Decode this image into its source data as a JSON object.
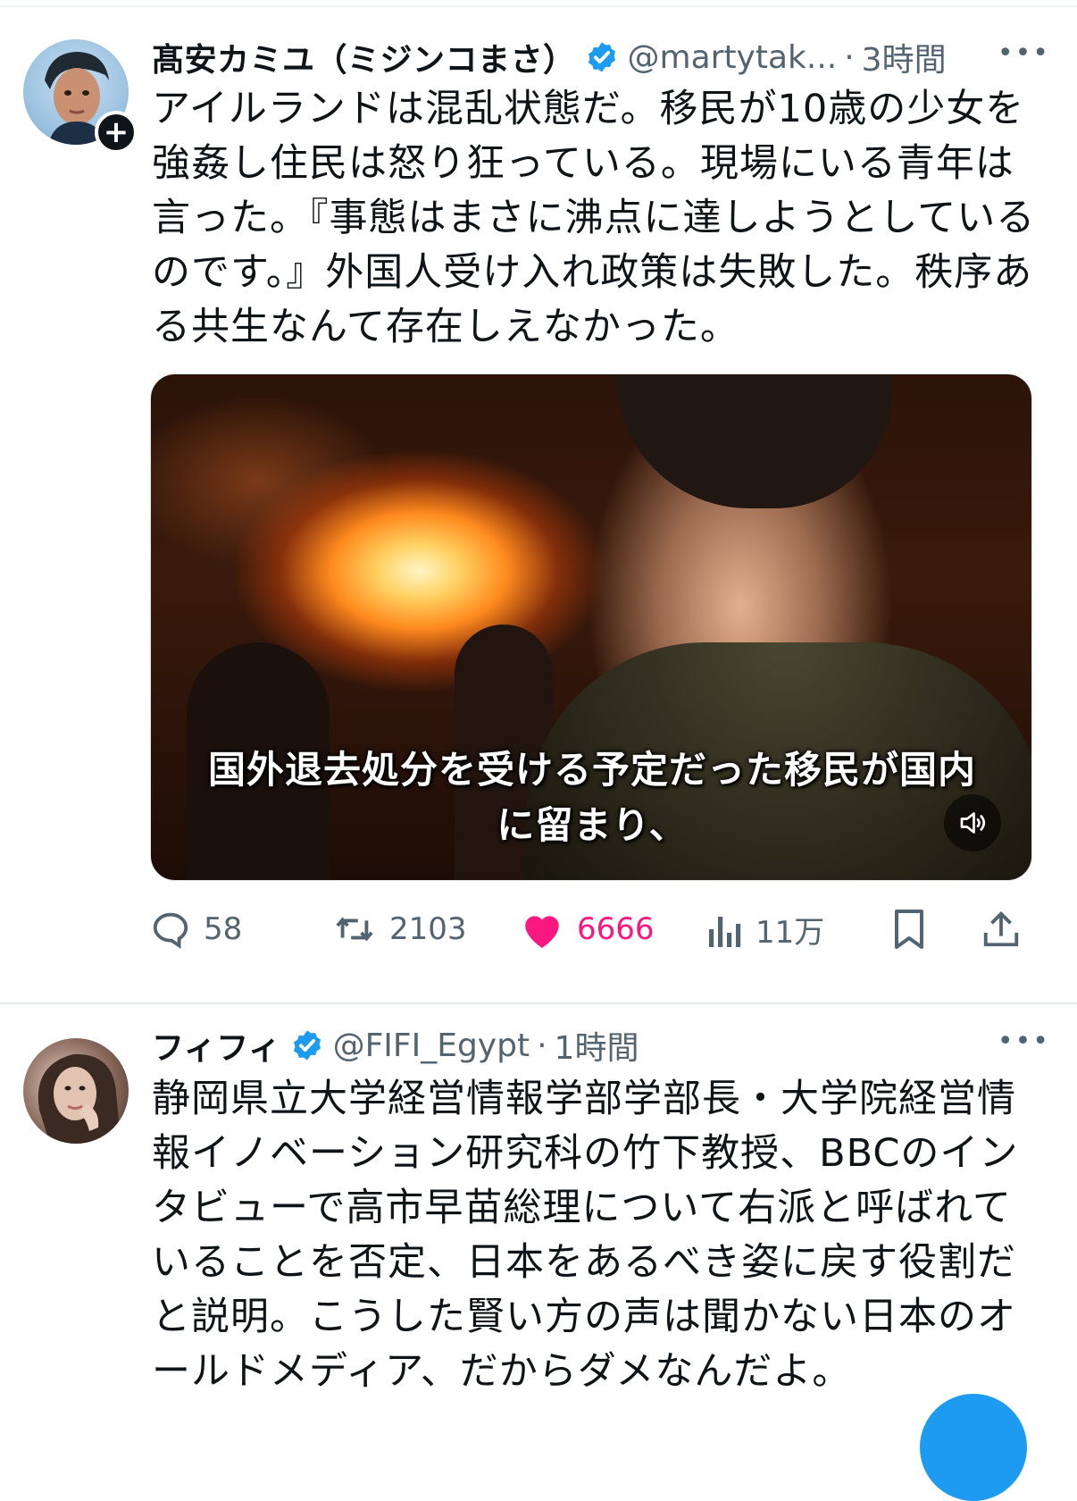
{
  "tweets": [
    {
      "display_name": "髙安カミユ（ミジンコまさ）",
      "handle": "@martytak...",
      "separator": "·",
      "time": "3時間",
      "text": "アイルランドは混乱状態だ。移民が10歳の少女を強姦し住民は怒り狂っている。現場にいる青年は言った。『事態はまさに沸点に達しようとしているのです。』外国人受け入れ政策は失敗した。秩序ある共生なんて存在しえなかった。",
      "media": {
        "caption": "国外退去処分を受ける予定だった移民が国内に留まり、",
        "sound_icon": "speaker-icon"
      },
      "actions": {
        "replies": "58",
        "retweets": "2103",
        "likes": "6666",
        "views": "11万"
      }
    },
    {
      "display_name": "フィフィ",
      "handle": "@FIFI_Egypt",
      "separator": "·",
      "time": "1時間",
      "text": "静岡県立大学経営情報学部学部長・大学院経営情報イノベーション研究科の竹下教授、BBCのインタビューで高市早苗総理について右派と呼ばれていることを否定、日本をあるべき姿に戻す役割だと説明。こうした賢い方の声は聞かない日本のオールドメディア、だからダメなんだよ。"
    }
  ],
  "more_label": "•••",
  "colors": {
    "verified": "#1d9bf0",
    "like_active": "#f91880",
    "secondary_text": "#536471"
  }
}
